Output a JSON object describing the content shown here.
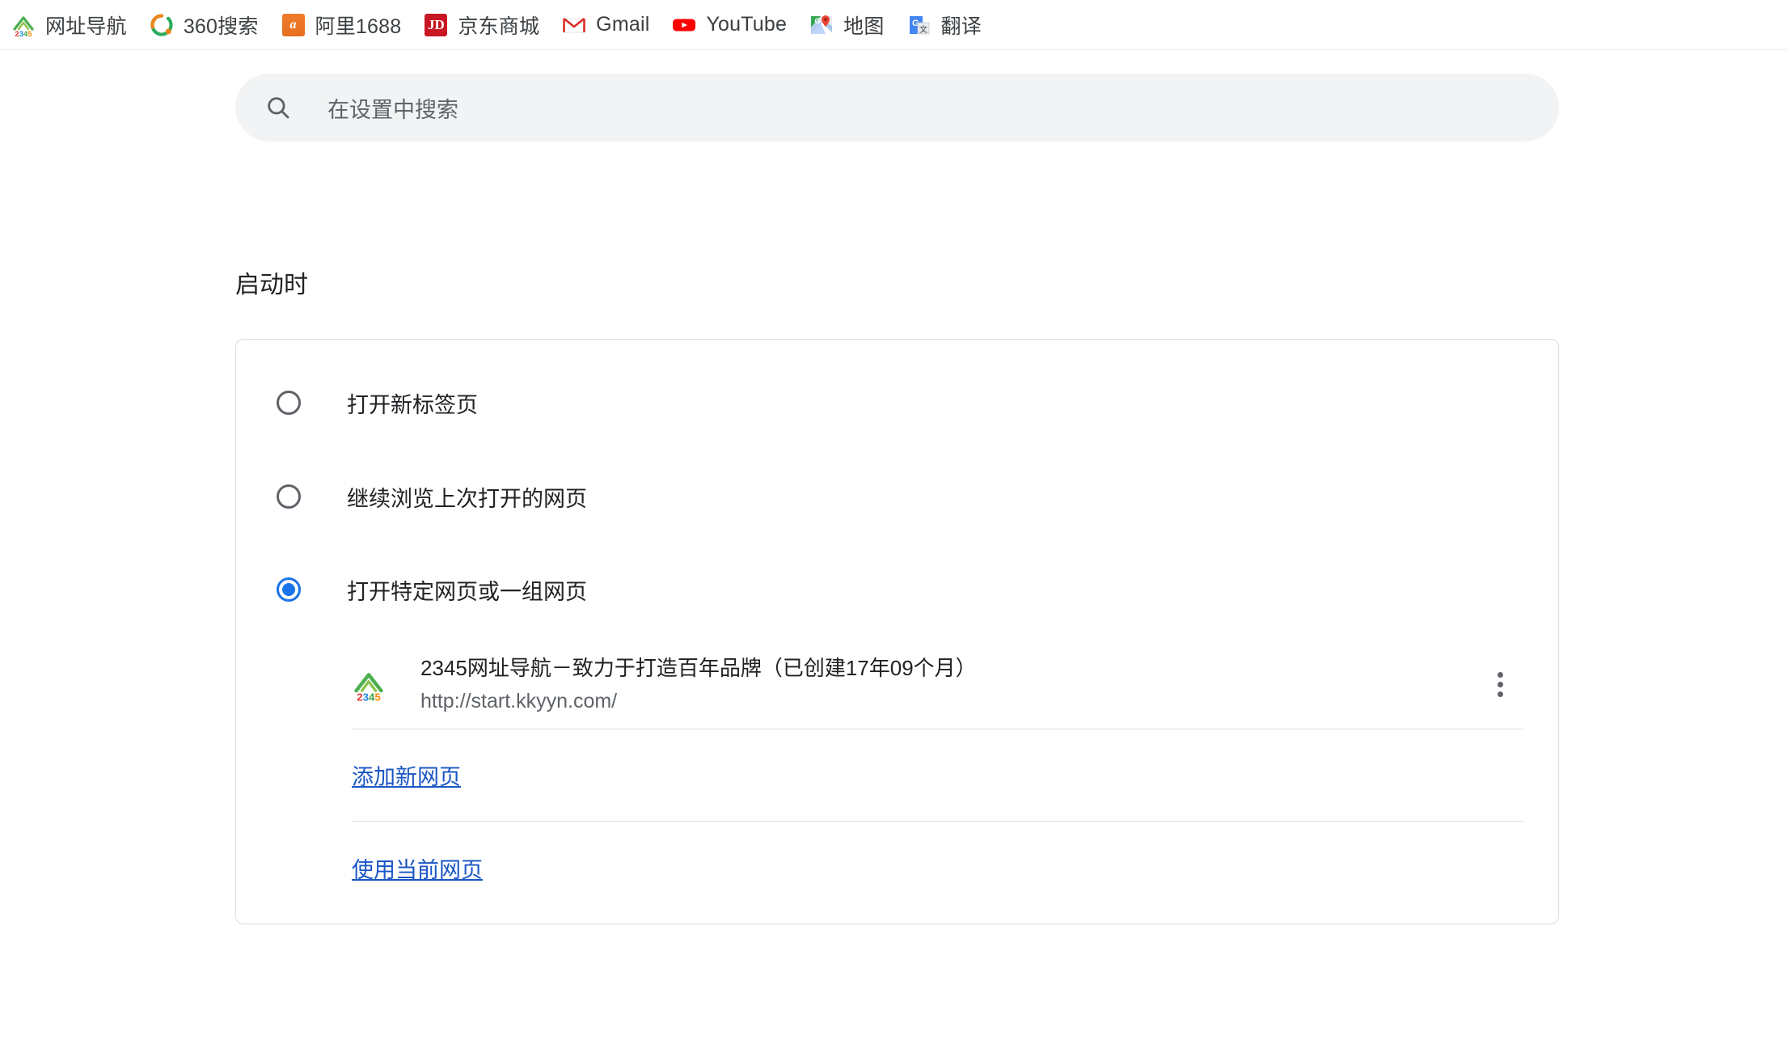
{
  "bookmarks_bar": {
    "items": [
      {
        "label": "网址导航",
        "icon": "house-2345-icon"
      },
      {
        "label": "360搜索",
        "icon": "360-search-icon"
      },
      {
        "label": "阿里1688",
        "icon": "alibaba-1688-icon"
      },
      {
        "label": "京东商城",
        "icon": "jd-icon"
      },
      {
        "label": "Gmail",
        "icon": "gmail-icon"
      },
      {
        "label": "YouTube",
        "icon": "youtube-icon"
      },
      {
        "label": "地图",
        "icon": "google-maps-icon"
      },
      {
        "label": "翻译",
        "icon": "google-translate-icon"
      }
    ]
  },
  "search": {
    "placeholder": "在设置中搜索",
    "value": "",
    "icon": "search-icon"
  },
  "settings": {
    "section_title": "启动时",
    "accent_color": "#1a73e8",
    "link_color": "#1a56c4",
    "startup_options": [
      {
        "label": "打开新标签页",
        "selected": false
      },
      {
        "label": "继续浏览上次打开的网页",
        "selected": false
      },
      {
        "label": "打开特定网页或一组网页",
        "selected": true
      }
    ],
    "startup_pages": [
      {
        "title": "2345网址导航－致力于打造百年品牌（已创建17年09个月）",
        "url": "http://start.kkyyn.com/",
        "favicon": "house-2345-icon",
        "menu_icon": "more-vert-icon"
      }
    ],
    "actions": {
      "add_new_page": "添加新网页",
      "use_current_pages": "使用当前网页"
    }
  }
}
